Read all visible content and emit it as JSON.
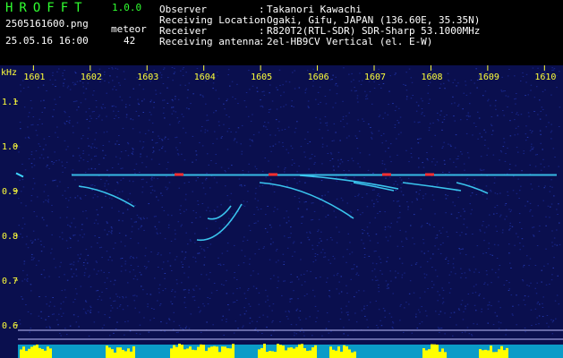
{
  "header": {
    "app_title": "HROFFT",
    "app_version": "1.0.0",
    "file_name": "2505161600.png",
    "date_time": "25.05.16 16:00",
    "meteor_label": "meteor",
    "meteor_count": "42"
  },
  "info": [
    {
      "label": "Observer",
      "sep": ":",
      "value": "Takanori Kawachi"
    },
    {
      "label": "Receiving Location",
      "sep": ":",
      "value": "Ogaki, Gifu, JAPAN (136.60E, 35.35N)"
    },
    {
      "label": "Receiver",
      "sep": ":",
      "value": "R820T2(RTL-SDR) SDR-Sharp 53.1000MHz"
    },
    {
      "label": "Receiving antenna",
      "sep": ":",
      "value": "2el-HB9CV Vertical (el. E-W)"
    }
  ],
  "chart_data": {
    "type": "heatmap",
    "ylabel": "kHz",
    "x_ticks": [
      "1601",
      "1602",
      "1603",
      "1604",
      "1605",
      "1606",
      "1607",
      "1608",
      "1609",
      "1610"
    ],
    "y_ticks": [
      "1.1",
      "1.0",
      "0.9",
      "0.8",
      "0.7",
      "0.6"
    ],
    "ylim": [
      0.58,
      1.17
    ],
    "xlim": [
      1600.6,
      1610.2
    ],
    "carrier_khz": 0.935,
    "colors": {
      "background": "#0a0f4e",
      "noise": "#1c2c9a",
      "signal": "#3fd8ff",
      "peak": "#ff3030",
      "bottom_band": "#0a9cc8",
      "activity": "#ffff00",
      "text_axis": "#ffff3a"
    }
  }
}
